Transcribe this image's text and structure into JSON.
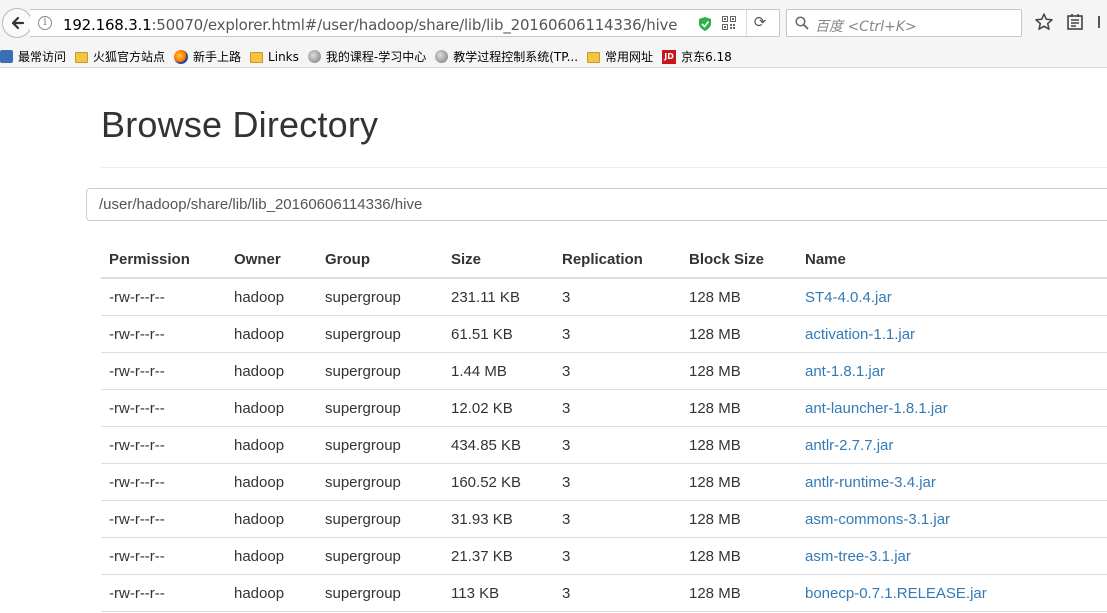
{
  "browser": {
    "url_host": "192.168.3.1",
    "url_rest": ":50070/explorer.html#/user/hadoop/share/lib/lib_20160606114336/hive",
    "search_placeholder": "百度 <Ctrl+K>",
    "bookmarks": [
      {
        "label": "最常访问",
        "icon": "star-bookmark-icon"
      },
      {
        "label": "火狐官方站点",
        "icon": "folder-icon"
      },
      {
        "label": "新手上路",
        "icon": "firefox-icon"
      },
      {
        "label": "Links",
        "icon": "folder-icon"
      },
      {
        "label": "我的课程-学习中心",
        "icon": "globe-icon"
      },
      {
        "label": "教学过程控制系统(TP...",
        "icon": "globe-icon"
      },
      {
        "label": "常用网址",
        "icon": "folder-icon"
      },
      {
        "label": "京东6.18",
        "icon": "jd-icon"
      }
    ]
  },
  "page": {
    "title": "Browse Directory",
    "path_value": "/user/hadoop/share/lib/lib_20160606114336/hive"
  },
  "table": {
    "headers": [
      "Permission",
      "Owner",
      "Group",
      "Size",
      "Replication",
      "Block Size",
      "Name"
    ],
    "rows": [
      [
        "-rw-r--r--",
        "hadoop",
        "supergroup",
        "231.11 KB",
        "3",
        "128 MB",
        "ST4-4.0.4.jar"
      ],
      [
        "-rw-r--r--",
        "hadoop",
        "supergroup",
        "61.51 KB",
        "3",
        "128 MB",
        "activation-1.1.jar"
      ],
      [
        "-rw-r--r--",
        "hadoop",
        "supergroup",
        "1.44 MB",
        "3",
        "128 MB",
        "ant-1.8.1.jar"
      ],
      [
        "-rw-r--r--",
        "hadoop",
        "supergroup",
        "12.02 KB",
        "3",
        "128 MB",
        "ant-launcher-1.8.1.jar"
      ],
      [
        "-rw-r--r--",
        "hadoop",
        "supergroup",
        "434.85 KB",
        "3",
        "128 MB",
        "antlr-2.7.7.jar"
      ],
      [
        "-rw-r--r--",
        "hadoop",
        "supergroup",
        "160.52 KB",
        "3",
        "128 MB",
        "antlr-runtime-3.4.jar"
      ],
      [
        "-rw-r--r--",
        "hadoop",
        "supergroup",
        "31.93 KB",
        "3",
        "128 MB",
        "asm-commons-3.1.jar"
      ],
      [
        "-rw-r--r--",
        "hadoop",
        "supergroup",
        "21.37 KB",
        "3",
        "128 MB",
        "asm-tree-3.1.jar"
      ],
      [
        "-rw-r--r--",
        "hadoop",
        "supergroup",
        "113 KB",
        "3",
        "128 MB",
        "bonecp-0.7.1.RELEASE.jar"
      ]
    ]
  }
}
